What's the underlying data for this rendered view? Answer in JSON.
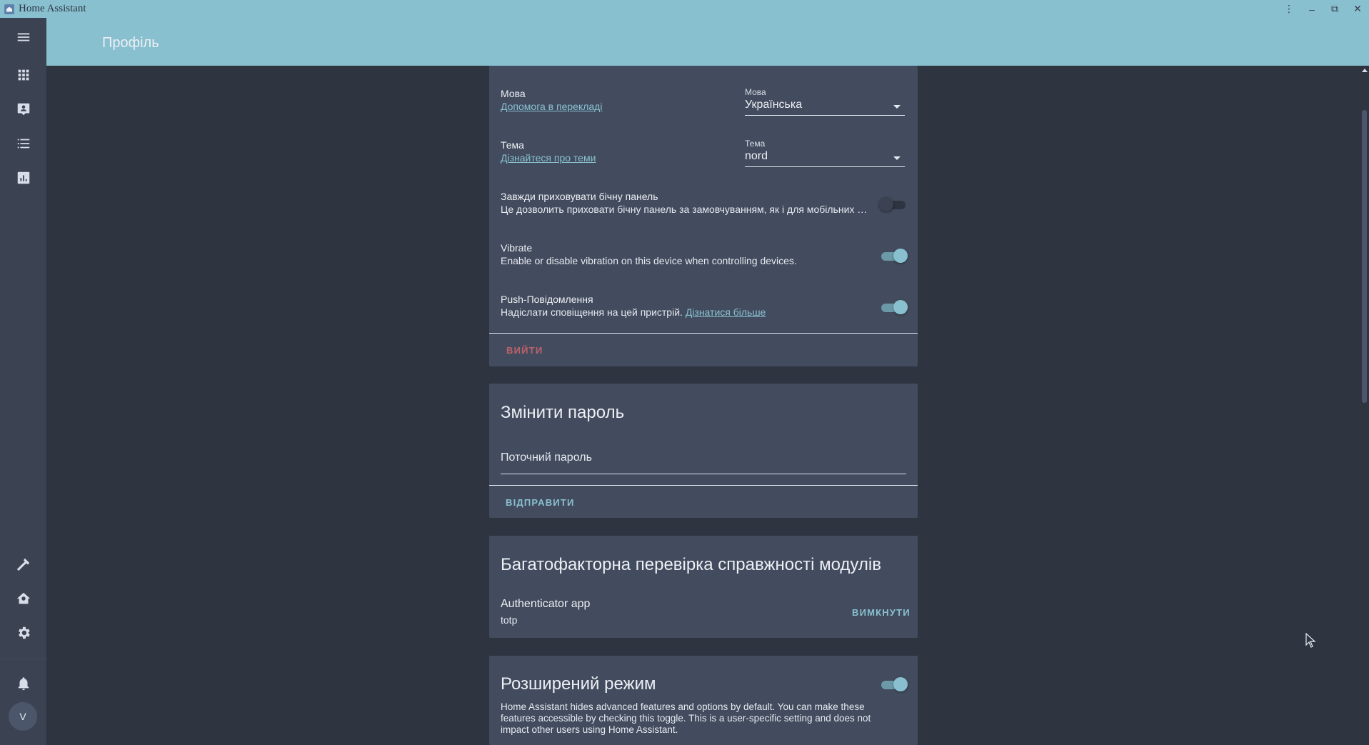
{
  "window": {
    "title": "Home Assistant",
    "controls": {
      "menu": "⋮",
      "minimize": "–",
      "restore": "⧉",
      "close": "✕"
    }
  },
  "header": {
    "title": "Профіль"
  },
  "sidebar": {
    "items": [
      {
        "name": "menu-icon"
      },
      {
        "name": "overview-grid-icon"
      },
      {
        "name": "map-icon"
      },
      {
        "name": "logbook-icon"
      },
      {
        "name": "history-icon"
      },
      {
        "name": "developer-tools-icon"
      },
      {
        "name": "supervisor-icon"
      },
      {
        "name": "settings-icon"
      },
      {
        "name": "notifications-icon"
      }
    ],
    "avatar_initial": "V"
  },
  "general": {
    "language": {
      "label": "Мова",
      "link": "Допомога в перекладі",
      "select_label": "Мова",
      "select_value": "Українська"
    },
    "theme": {
      "label": "Тема",
      "link": "Дізнайтеся про теми",
      "select_label": "Тема",
      "select_value": "nord"
    },
    "hide_sidebar": {
      "label": "Завжди приховувати бічну панель",
      "desc": "Це дозволить приховати бічну панель за замовчуванням, як і для мобільних пристроїв.",
      "on": false
    },
    "vibrate": {
      "label": "Vibrate",
      "desc": "Enable or disable vibration on this device when controlling devices.",
      "on": true
    },
    "push": {
      "label": "Push-Повідомлення",
      "desc": "Надіслати сповіщення на цей пристрій.",
      "link": "Дізнатися більше",
      "on": true
    },
    "logout_label": "Вийти"
  },
  "change_password": {
    "title": "Змінити пароль",
    "current_password_placeholder": "Поточний пароль",
    "submit_label": "Відправити"
  },
  "mfa": {
    "title": "Багатофакторна перевірка справжності модулів",
    "module_name": "Authenticator app",
    "module_id": "totp",
    "disable_label": "Вимкнути"
  },
  "advanced": {
    "title": "Розширений режим",
    "desc": "Home Assistant hides advanced features and options by default. You can make these features accessible by checking this toggle. This is a user-specific setting and does not impact other users using Home Assistant.",
    "on": true
  },
  "colors": {
    "accent": "#88c0d0",
    "background": "#2e3440",
    "card": "#434c5e",
    "danger": "#bf616a"
  }
}
